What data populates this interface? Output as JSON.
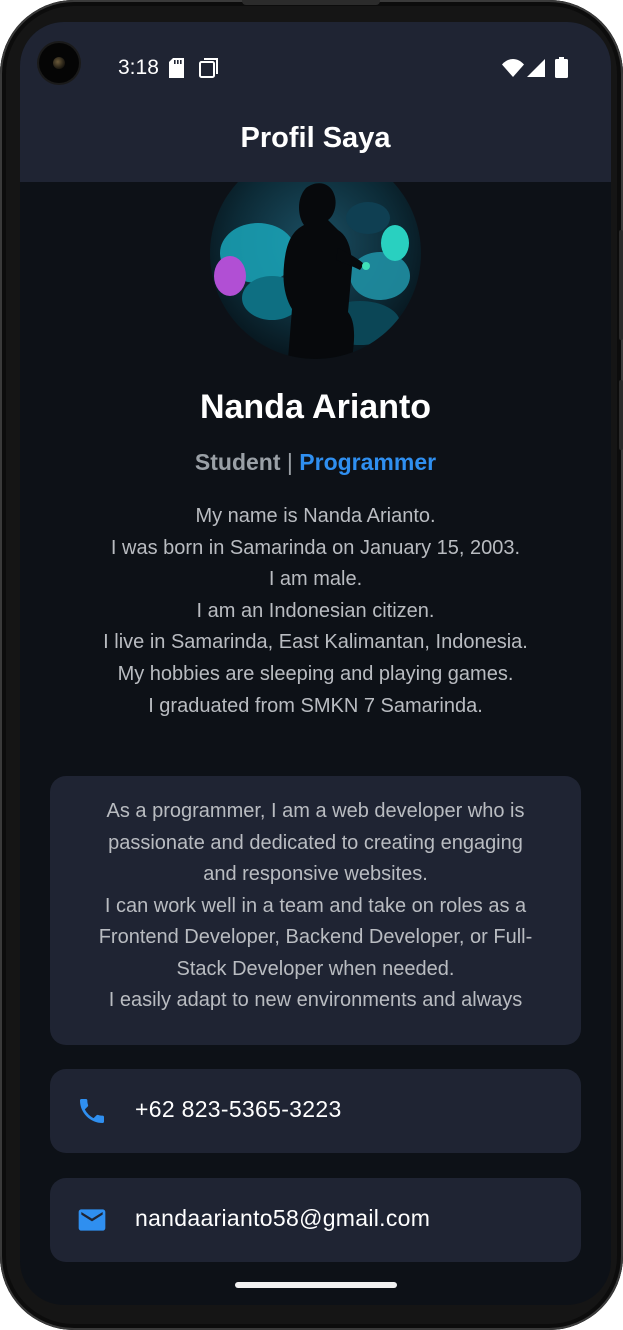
{
  "status": {
    "time": "3:18"
  },
  "app": {
    "title": "Profil Saya"
  },
  "profile": {
    "name": "Nanda Arianto",
    "role_primary": "Student",
    "role_separator": "|",
    "role_secondary": "Programmer",
    "bio_lines": [
      "My name is Nanda Arianto.",
      "I was born in Samarinda on January 15, 2003.",
      "I am male.",
      "I am an Indonesian citizen.",
      "I live in Samarinda, East Kalimantan, Indonesia.",
      "My hobbies are sleeping and playing games.",
      "I graduated from SMKN 7 Samarinda."
    ]
  },
  "about": {
    "lines": [
      "As a programmer, I am a web developer who is",
      "passionate and dedicated to creating engaging",
      "and responsive websites.",
      "I can work well in a team and take on roles as a",
      "Frontend Developer, Backend Developer, or Full-",
      "Stack Developer when needed.",
      "I easily adapt to new environments and always"
    ]
  },
  "contacts": {
    "phone": {
      "icon": "phone-icon",
      "value": "+62 823-5365-3223"
    },
    "email": {
      "icon": "mail-icon",
      "value": "nandaarianto58@gmail.com"
    }
  },
  "colors": {
    "background": "#0d1117",
    "app_bar": "#1f2433",
    "card": "#1f2433",
    "accent": "#2f8ff0",
    "muted_text": "#b9bcc1"
  }
}
